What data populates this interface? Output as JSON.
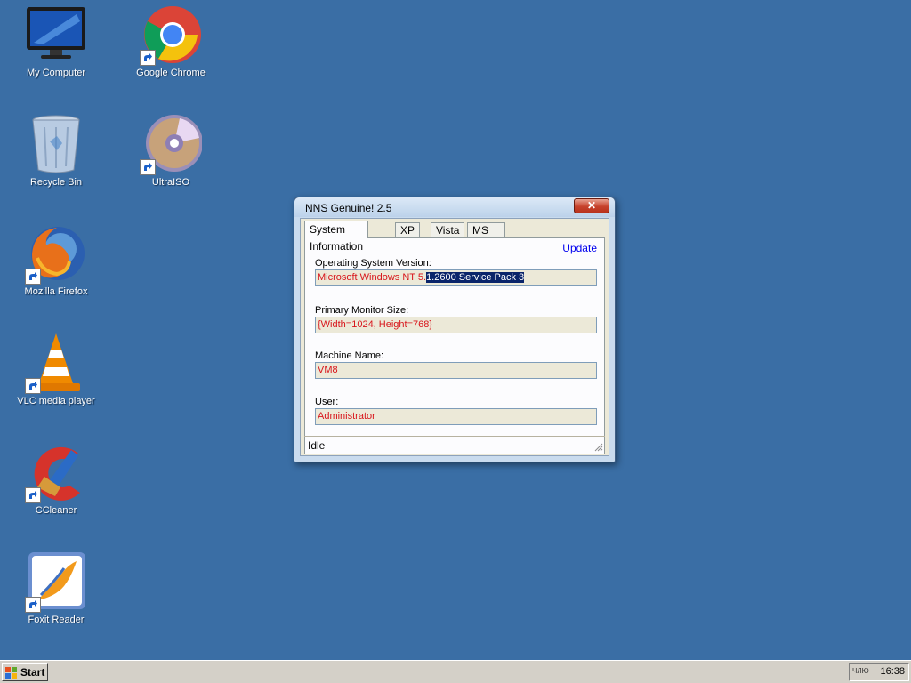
{
  "desktop": {
    "icons": [
      {
        "label": "My Computer",
        "icon": "monitor-icon"
      },
      {
        "label": "Google Chrome",
        "icon": "chrome-icon"
      },
      {
        "label": "Recycle Bin",
        "icon": "recycle-bin-icon"
      },
      {
        "label": "UltraISO",
        "icon": "disc-icon"
      },
      {
        "label": "Mozilla Firefox",
        "icon": "firefox-icon"
      },
      {
        "label": "VLC media player",
        "icon": "vlc-cone-icon"
      },
      {
        "label": "CCleaner",
        "icon": "ccleaner-icon"
      },
      {
        "label": "Foxit Reader",
        "icon": "foxit-icon"
      }
    ]
  },
  "window": {
    "title": "NNS Genuine! 2.5",
    "close_label": "✕",
    "tabs": [
      {
        "label": "System Information",
        "active": true
      },
      {
        "label": "XP",
        "active": false
      },
      {
        "label": "Vista",
        "active": false
      },
      {
        "label": "MS Office",
        "active": false
      }
    ],
    "update_link": "Update",
    "fields": {
      "os_label": "Operating System Version:",
      "os_value_unselected": "Microsoft Windows NT 5.",
      "os_value_selected": "1.2600 Service Pack 3",
      "monitor_label": "Primary Monitor Size:",
      "monitor_value": "{Width=1024, Height=768}",
      "machine_label": "Machine Name:",
      "machine_value": "VM8",
      "user_label": "User:",
      "user_value": "Administrator"
    },
    "status": "Idle"
  },
  "taskbar": {
    "start_label": "Start",
    "tray_lang": "ЧЛЮ",
    "clock": "16:38"
  },
  "colors": {
    "desktop_bg": "#3a6ea5",
    "field_text": "#d8151b",
    "selection_bg": "#0a246a"
  }
}
